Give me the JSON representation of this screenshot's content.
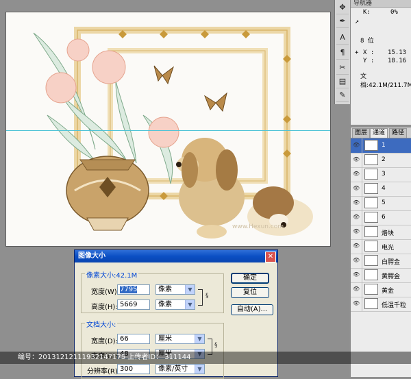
{
  "info_panel": {
    "tab_label": "导航器",
    "k_label": "K:",
    "k_value": "0%",
    "bit_depth": "8 位",
    "x_label": "X :",
    "x_value": "15.13",
    "y_label": "Y :",
    "y_value": "18.16",
    "doc_size": "文档:42.1M/211.7M"
  },
  "channels_panel": {
    "tabs": [
      "图层",
      "通道",
      "路径"
    ],
    "rows": [
      {
        "label": "1"
      },
      {
        "label": "2"
      },
      {
        "label": "3"
      },
      {
        "label": "4"
      },
      {
        "label": "5"
      },
      {
        "label": "6"
      },
      {
        "label": "烙块"
      },
      {
        "label": "电光"
      },
      {
        "label": "白腭金"
      },
      {
        "label": "黄腭金"
      },
      {
        "label": "黄金"
      },
      {
        "label": "低温千粒"
      }
    ]
  },
  "dialog": {
    "title": "图像大小",
    "pixel_group_title": "像素大小:42.1M",
    "width_label": "宽度(W):",
    "width_value": "7795",
    "width_unit": "像素",
    "height_label": "高度(H):",
    "height_value": "5669",
    "height_unit": "像素",
    "doc_group_title": "文档大小:",
    "doc_width_label": "宽度(D):",
    "doc_width_value": "66",
    "doc_width_unit": "厘米",
    "doc_height_label": "高度(G):",
    "doc_height_value": "48",
    "doc_height_unit": "厘米",
    "res_label": "分辨率(R):",
    "res_value": "300",
    "res_unit": "像素/英寸",
    "ok_label": "确定",
    "reset_label": "复位",
    "auto_label": "自动(A)..."
  },
  "watermark": {
    "text": "编号：20131212111932147175 上传者ID： 311144",
    "site_text": "www.Hexun.com"
  }
}
